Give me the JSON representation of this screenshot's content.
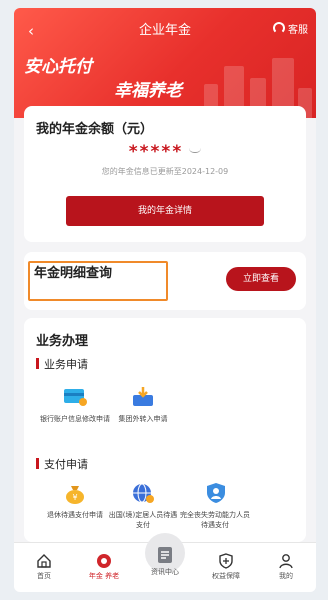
{
  "header": {
    "back_icon": "chevron-left-icon",
    "title": "企业年金",
    "service_label": "客服",
    "service_icon": "headset-icon"
  },
  "banner": {
    "slogan_left": "安心托付",
    "slogan_right": "幸福养老",
    "colors": {
      "primary": "#e8302c",
      "accent": "#b8141c"
    }
  },
  "balance": {
    "title": "我的年金余额（元）",
    "masked_value": "*****",
    "eye_icon": "eye-closed-icon",
    "updated_text": "您的年金信息已更新至2024-12-09",
    "detail_button": "我的年金详情"
  },
  "query": {
    "label": "年金明细查询",
    "button": "立即查看",
    "highlight_color": "#f08a2a"
  },
  "business": {
    "title": "业务办理",
    "section1": {
      "title": "业务申请",
      "items": [
        {
          "label": "银行账户信息修改申请",
          "icon": "bank-card-icon"
        },
        {
          "label": "集团外转入申请",
          "icon": "transfer-in-icon"
        }
      ]
    },
    "section2": {
      "title": "支付申请",
      "items": [
        {
          "label": "退休待遇支付申请",
          "icon": "money-bag-icon"
        },
        {
          "label": "出国(境)定居人员待遇支付",
          "icon": "globe-icon"
        },
        {
          "label": "完全丧失劳动能力人员待遇支付",
          "icon": "person-shield-icon"
        }
      ]
    }
  },
  "tabbar": {
    "items": [
      {
        "label": "首页",
        "icon": "home-icon"
      },
      {
        "label": "年金 养老",
        "icon": "pension-icon"
      },
      {
        "label": "资讯中心",
        "icon": "document-icon"
      },
      {
        "label": "权益保障",
        "icon": "shield-icon"
      },
      {
        "label": "我的",
        "icon": "user-icon"
      }
    ]
  }
}
